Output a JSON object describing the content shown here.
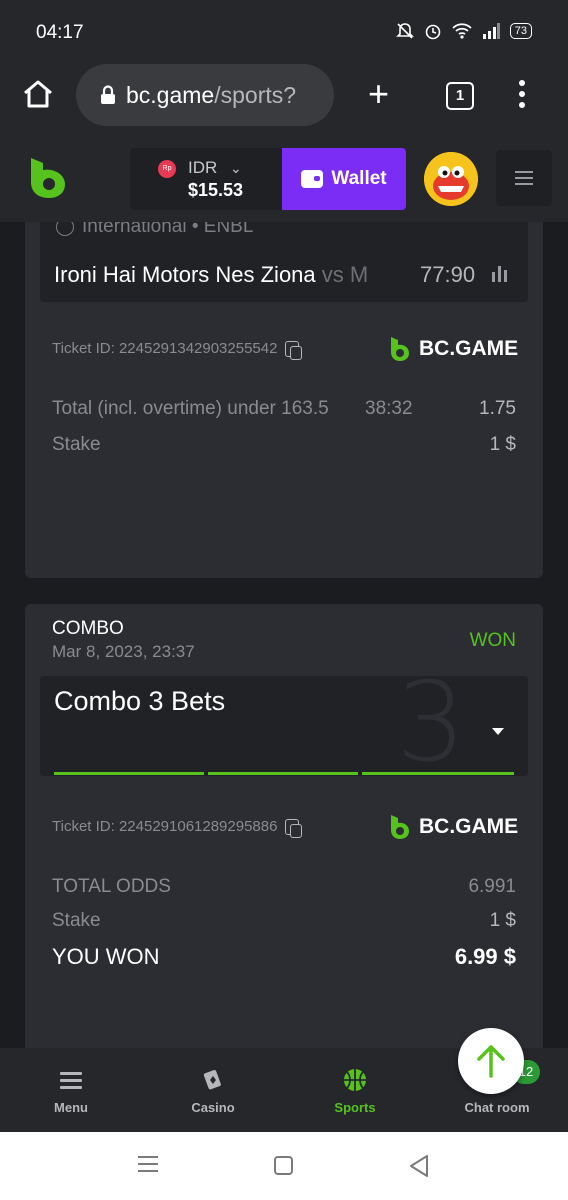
{
  "status_bar": {
    "time": "04:17",
    "battery": "73"
  },
  "browser": {
    "url_host": "bc.game",
    "url_path": "/sports?",
    "tab_count": "1"
  },
  "header": {
    "currency_code": "IDR",
    "currency_badge": "Rp",
    "balance": "$15.53",
    "wallet_label": "Wallet"
  },
  "bet1": {
    "league": "International • ENBL",
    "team1": "Ironi Hai Motors Nes Ziona",
    "vs": "vs M",
    "score": "77:90",
    "ticket_id": "Ticket ID: 2245291342903255542",
    "brand": "BC.GAME",
    "selection": "Total (incl. overtime) under 163.5",
    "selection_score": "38:32",
    "odds": "1.75",
    "stake_label": "Stake",
    "stake_value": "1 $"
  },
  "bet2": {
    "type": "COMBO",
    "date": "Mar 8, 2023, 23:37",
    "status": "WON",
    "title": "Combo 3 Bets",
    "count": "3",
    "ticket_id": "Ticket ID: 2245291061289295886",
    "brand": "BC.GAME",
    "total_odds_label": "TOTAL ODDS",
    "total_odds_value": "6.991",
    "stake_label": "Stake",
    "stake_value": "1 $",
    "won_label": "YOU WON",
    "won_value": "6.99 $"
  },
  "bottom_nav": {
    "items": [
      {
        "label": "Menu"
      },
      {
        "label": "Casino"
      },
      {
        "label": "Sports"
      },
      {
        "label": "Chat room"
      }
    ],
    "chat_badge": "12"
  },
  "colors": {
    "accent_green": "#56c21e",
    "wallet_purple": "#7b2cf5",
    "background": "#1b1c20"
  }
}
